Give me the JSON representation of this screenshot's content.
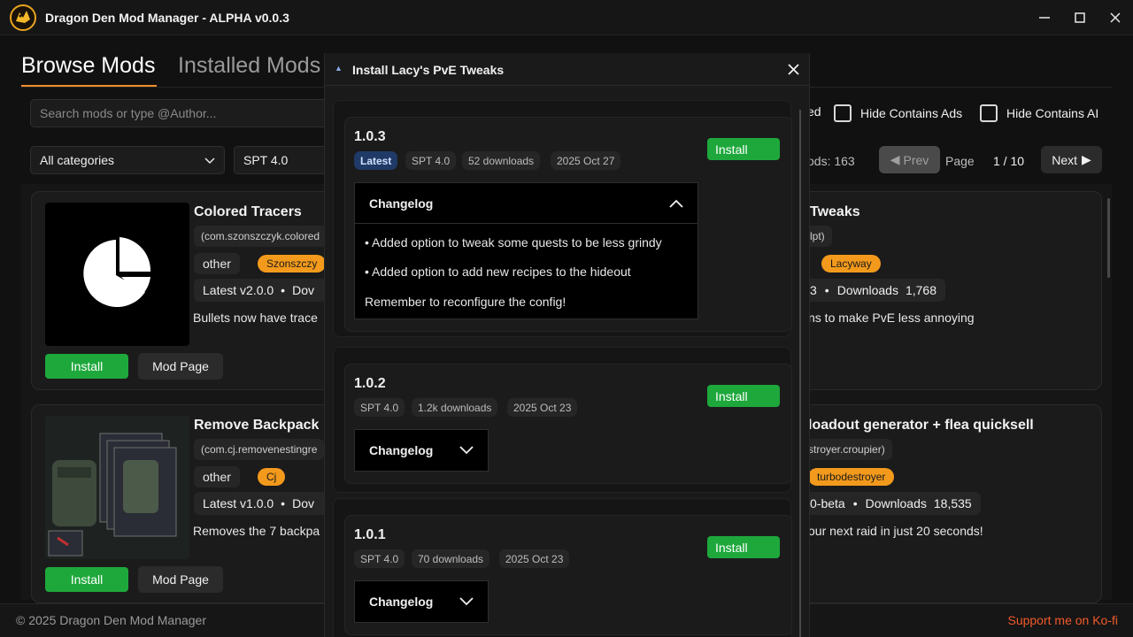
{
  "app": {
    "title": "Dragon Den Mod Manager - ALPHA v0.0.3"
  },
  "tabs": {
    "browse": "Browse Mods",
    "installed": "Installed Mods"
  },
  "search": {
    "placeholder": "Search mods or type @Author..."
  },
  "filters": {
    "hide_installed_partial": "ed",
    "hide_ads": "Hide Contains Ads",
    "hide_ai": "Hide Contains AI",
    "category": "All categories",
    "spt": "SPT 4.0"
  },
  "pagination": {
    "total": "ods: 163",
    "prev": "Prev",
    "page_label": "Page",
    "page": "1 / 10",
    "next": "Next"
  },
  "mods": [
    {
      "title": "Colored Tracers",
      "guid": "(com.szonszczyk.colored",
      "category": "other",
      "author": "Szonszczy",
      "version_text": "Latest v2.0.0",
      "downloads_partial": "Dov",
      "desc": "Bullets now have trace",
      "install": "Install",
      "mod_page": "Mod Page"
    },
    {
      "title_partial": "Tweaks",
      "guid_partial": "lpt)",
      "author": "Lacyway",
      "version_partial": "3",
      "downloads_label": "Downloads",
      "downloads": "1,768",
      "desc_partial": "ns to make PvE less annoying"
    },
    {
      "title": "Remove Backpack",
      "guid": "(com.cj.removenestingre",
      "category": "other",
      "author": "Cj",
      "version_text": "Latest v1.0.0",
      "downloads_partial": "Dov",
      "desc": "Removes the 7 backpa",
      "install": "Install",
      "mod_page": "Mod Page"
    },
    {
      "title_partial": "loadout generator + flea quicksell",
      "guid_partial": "stroyer.croupier)",
      "author": "turbodestroyer",
      "version_partial": "0-beta",
      "downloads_label": "Downloads",
      "downloads": "18,535",
      "desc_partial": "our next raid in just 20 seconds!"
    }
  ],
  "dialog": {
    "title": "Install Lacy's PvE Tweaks",
    "install_label": "Install",
    "changelog_label": "Changelog",
    "versions": [
      {
        "number": "1.0.3",
        "latest": "Latest",
        "spt": "SPT 4.0",
        "downloads": "52 downloads",
        "date": "2025 Oct 27",
        "changelog": [
          "• Added option to tweak some quests to be less grindy",
          "• Added option to add new recipes to the hideout",
          "Remember to reconfigure the config!"
        ]
      },
      {
        "number": "1.0.2",
        "spt": "SPT 4.0",
        "downloads": "1.2k downloads",
        "date": "2025 Oct 23"
      },
      {
        "number": "1.0.1",
        "spt": "SPT 4.0",
        "downloads": "70 downloads",
        "date": "2025 Oct 23"
      }
    ]
  },
  "footer": {
    "copyright": "© 2025 Dragon Den Mod Manager",
    "kofi": "Support me on Ko-fi"
  },
  "colors": {
    "accent": "#f08c2a",
    "install_green": "#1ea83c",
    "author_orange": "#f39a1c",
    "latest_blue": "#1f3a66",
    "kofi": "#f25a2b"
  },
  "icons": [
    "dragon-logo-icon",
    "minimize-icon",
    "maximize-icon",
    "close-icon",
    "chevron-down-icon",
    "chevron-up-icon",
    "prev-arrow-icon",
    "next-arrow-icon",
    "pie-chart-icon",
    "collapse-arrow-icon"
  ]
}
